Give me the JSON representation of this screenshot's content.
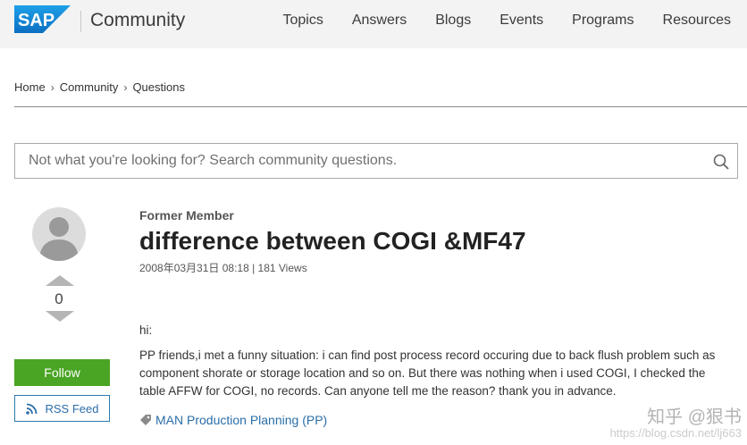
{
  "header": {
    "logo_text": "SAP",
    "brand": "Community",
    "nav": [
      "Topics",
      "Answers",
      "Blogs",
      "Events",
      "Programs",
      "Resources"
    ]
  },
  "breadcrumb": [
    "Home",
    "Community",
    "Questions"
  ],
  "search": {
    "placeholder": "Not what you're looking for? Search community questions."
  },
  "question": {
    "author": "Former Member",
    "title": "difference between COGI &MF47",
    "meta": "2008年03月31日 08:18 | 181 Views",
    "votes": "0",
    "body": [
      "hi:",
      "PP friends,i met a funny situation: i can find post process record occuring due to back flush problem such as component shorate or storage location and so on. But there was nothing when i used COGI, I checked the table AFFW for COGI, no records. Can anyone tell me the reason? thank you in advance."
    ],
    "tag": "MAN Production Planning (PP)"
  },
  "actions": {
    "follow": "Follow",
    "rss": "RSS Feed"
  },
  "watermark": {
    "main": "知乎 @狠书",
    "url": "https://blog.csdn.net/lj663"
  },
  "colors": {
    "sap_blue": "#1a8ad6",
    "follow_green": "#4aa524",
    "link_blue": "#2a6ea8"
  }
}
